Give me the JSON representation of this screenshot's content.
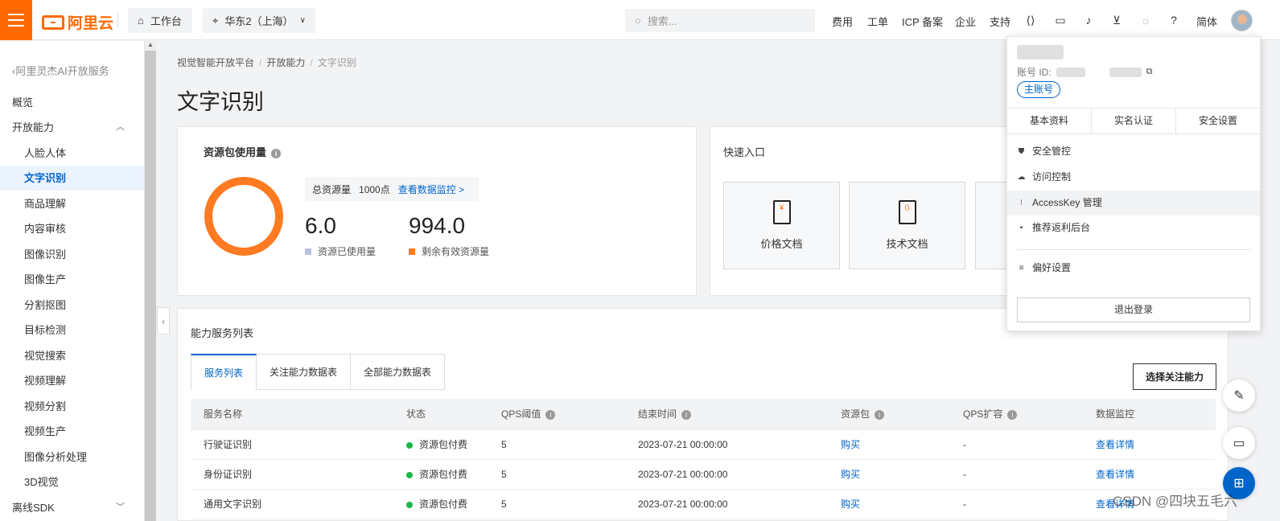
{
  "topbar": {
    "logo_text": "阿里云",
    "workbench": "工作台",
    "region": "华东2（上海）",
    "search_placeholder": "搜索...",
    "links": [
      "费用",
      "工单",
      "ICP 备案",
      "企业",
      "支持"
    ],
    "lang": "简体"
  },
  "sidebar": {
    "back": "阿里灵杰AI开放服务",
    "overview": "概览",
    "group": "开放能力",
    "items": [
      "人脸人体",
      "文字识别",
      "商品理解",
      "内容审核",
      "图像识别",
      "图像生产",
      "分割抠图",
      "目标检测",
      "视觉搜索",
      "视频理解",
      "视频分割",
      "视频生产",
      "图像分析处理",
      "3D视觉"
    ],
    "active_index": 1,
    "bottom": "离线SDK"
  },
  "breadcrumb": [
    "视觉智能开放平台",
    "开放能力",
    "文字识别"
  ],
  "page_title": "文字识别",
  "usage": {
    "title": "资源包使用量",
    "total_label": "总资源量",
    "total_value": "1000点",
    "monitor_link": "查看数据监控 >",
    "used_value": "6.0",
    "used_label": "资源已使用量",
    "remaining_value": "994.0",
    "remaining_label": "剩余有效资源量",
    "used_color": "#b8c2e0",
    "remaining_color": "#ff7a21"
  },
  "quick": {
    "title": "快速入口",
    "tiles": [
      "价格文档",
      "技术文档"
    ]
  },
  "services": {
    "title": "能力服务列表",
    "tabs": [
      "服务列表",
      "关注能力数据表",
      "全部能力数据表"
    ],
    "select_button": "选择关注能力",
    "columns": [
      "服务名称",
      "状态",
      "QPS阈值",
      "结束时间",
      "资源包",
      "QPS扩容",
      "数据监控"
    ],
    "rows": [
      {
        "name": "行驶证识别",
        "status": "资源包付费",
        "qps": "5",
        "end": "2023-07-21 00:00:00",
        "pkg": "购买",
        "expand": "-",
        "monitor": "查看详情"
      },
      {
        "name": "身份证识别",
        "status": "资源包付费",
        "qps": "5",
        "end": "2023-07-21 00:00:00",
        "pkg": "购买",
        "expand": "-",
        "monitor": "查看详情"
      },
      {
        "name": "通用文字识别",
        "status": "资源包付费",
        "qps": "5",
        "end": "2023-07-21 00:00:00",
        "pkg": "购买",
        "expand": "-",
        "monitor": "查看详情"
      }
    ]
  },
  "account_menu": {
    "account_id_label": "账号 ID:",
    "badge": "主账号",
    "tabs": [
      "基本资料",
      "实名认证",
      "安全设置"
    ],
    "items": [
      "安全管控",
      "访问控制",
      "AccessKey 管理",
      "推荐返利后台"
    ],
    "prefs": "偏好设置",
    "logout": "退出登录"
  },
  "watermark": "CSDN @四块五毛六"
}
